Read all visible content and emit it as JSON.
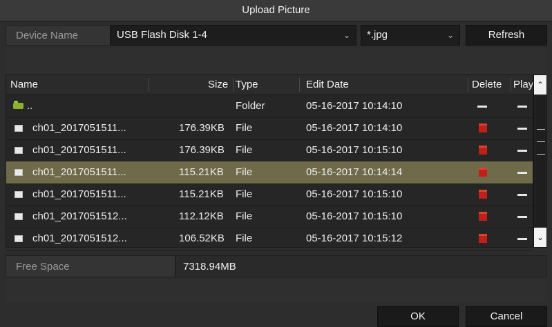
{
  "dialog": {
    "title": "Upload Picture"
  },
  "device": {
    "label": "Device Name",
    "selected": "USB Flash Disk 1-4",
    "filter": "*.jpg",
    "refresh_label": "Refresh"
  },
  "table": {
    "headers": {
      "name": "Name",
      "size": "Size",
      "type": "Type",
      "edit_date": "Edit Date",
      "delete": "Delete",
      "play": "Play"
    },
    "rows": [
      {
        "icon": "folder-icon",
        "name": "..",
        "size": "",
        "type": "Folder",
        "date": "05-16-2017 10:14:10"
      },
      {
        "icon": "file-icon",
        "name": "ch01_2017051511...",
        "size": "176.39KB",
        "type": "File",
        "date": "05-16-2017 10:14:10"
      },
      {
        "icon": "file-icon",
        "name": "ch01_2017051511...",
        "size": "176.39KB",
        "type": "File",
        "date": "05-16-2017 10:15:10"
      },
      {
        "icon": "file-icon",
        "name": "ch01_2017051511...",
        "size": "115.21KB",
        "type": "File",
        "date": "05-16-2017 10:14:14",
        "selected": true
      },
      {
        "icon": "file-icon",
        "name": "ch01_2017051511...",
        "size": "115.21KB",
        "type": "File",
        "date": "05-16-2017 10:15:10"
      },
      {
        "icon": "file-icon",
        "name": "ch01_2017051512...",
        "size": "112.12KB",
        "type": "File",
        "date": "05-16-2017 10:15:10"
      },
      {
        "icon": "file-icon",
        "name": "ch01_2017051512...",
        "size": "106.52KB",
        "type": "File",
        "date": "05-16-2017 10:15:12"
      }
    ]
  },
  "free_space": {
    "label": "Free Space",
    "value": "7318.94MB"
  },
  "footer": {
    "ok_label": "OK",
    "cancel_label": "Cancel"
  },
  "colors": {
    "selected_row": "#6f6a4a",
    "delete_icon": "#c0201a",
    "folder_icon": "#8db030"
  }
}
